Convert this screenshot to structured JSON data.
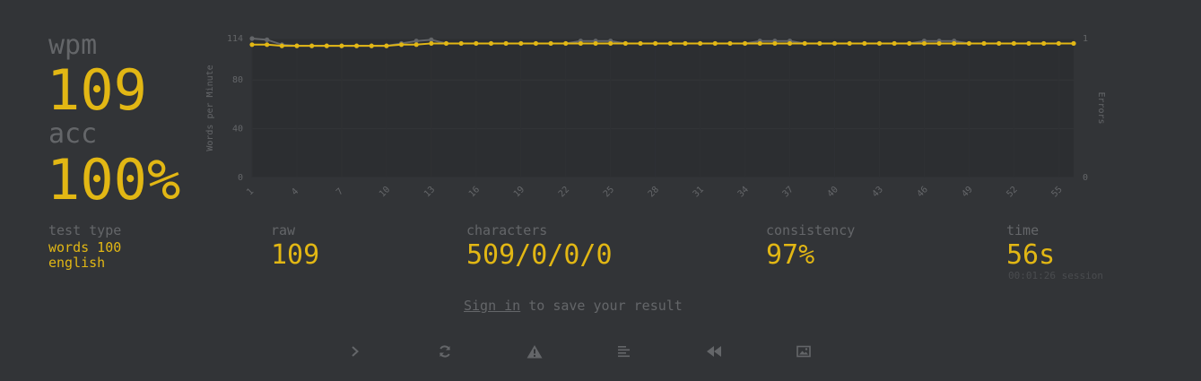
{
  "stats": {
    "wpm_label": "wpm",
    "wpm_value": "109",
    "acc_label": "acc",
    "acc_value": "100%"
  },
  "more": {
    "test_type_label": "test type",
    "test_type_line1": "words 100",
    "test_type_line2": "english",
    "raw_label": "raw",
    "raw_value": "109",
    "characters_label": "characters",
    "characters_value": "509/0/0/0",
    "consistency_label": "consistency",
    "consistency_value": "97%",
    "time_label": "time",
    "time_value": "56s",
    "session_text": "00:01:26 session"
  },
  "signin": {
    "link": "Sign in",
    "rest": " to save your result"
  },
  "buttons": [
    {
      "name": "next-test-button",
      "icon": "chevron-right-icon"
    },
    {
      "name": "restart-test-button",
      "icon": "refresh-icon"
    },
    {
      "name": "report-problem-button",
      "icon": "warning-icon"
    },
    {
      "name": "show-words-history-button",
      "icon": "align-left-icon"
    },
    {
      "name": "watch-replay-button",
      "icon": "backward-icon"
    },
    {
      "name": "save-screenshot-button",
      "icon": "image-icon"
    }
  ],
  "colors": {
    "background": "#323437",
    "accent": "#e2b714",
    "sub": "#646669",
    "chart_bg": "#2c2e31"
  },
  "chart_data": {
    "type": "line",
    "ylabel": "Words per Minute",
    "y2label": "Errors",
    "ylim": [
      0,
      114
    ],
    "y_ticks": [
      "0",
      "40",
      "80",
      "114"
    ],
    "y2lim": [
      0,
      1
    ],
    "y2_ticks": [
      "0",
      "1"
    ],
    "x": [
      1,
      2,
      3,
      4,
      5,
      6,
      7,
      8,
      9,
      10,
      11,
      12,
      13,
      14,
      15,
      16,
      17,
      18,
      19,
      20,
      21,
      22,
      23,
      24,
      25,
      26,
      27,
      28,
      29,
      30,
      31,
      32,
      33,
      34,
      35,
      36,
      37,
      38,
      39,
      40,
      41,
      42,
      43,
      44,
      45,
      46,
      47,
      48,
      49,
      50,
      51,
      52,
      53,
      54,
      55,
      56
    ],
    "x_ticks": [
      "1",
      "4",
      "7",
      "10",
      "13",
      "16",
      "19",
      "22",
      "25",
      "28",
      "31",
      "34",
      "37",
      "40",
      "43",
      "46",
      "49",
      "52",
      "55"
    ],
    "series": [
      {
        "name": "wpm",
        "color": "#e2b714",
        "values": [
          109,
          109,
          108,
          108,
          108,
          108,
          108,
          108,
          108,
          108,
          109,
          109,
          110,
          110,
          110,
          110,
          110,
          110,
          110,
          110,
          110,
          110,
          110,
          110,
          110,
          110,
          110,
          110,
          110,
          110,
          110,
          110,
          110,
          110,
          110,
          110,
          110,
          110,
          110,
          110,
          110,
          110,
          110,
          110,
          110,
          110,
          110,
          110,
          110,
          110,
          110,
          110,
          110,
          110,
          110,
          110
        ]
      },
      {
        "name": "raw",
        "color": "#646669",
        "values": [
          114,
          113,
          109,
          108,
          108,
          108,
          108,
          108,
          108,
          108,
          110,
          112,
          113,
          110,
          110,
          110,
          110,
          110,
          110,
          110,
          110,
          110,
          112,
          112,
          112,
          110,
          110,
          110,
          110,
          110,
          110,
          110,
          110,
          110,
          112,
          112,
          112,
          110,
          110,
          110,
          110,
          110,
          110,
          110,
          110,
          112,
          112,
          112,
          110,
          110,
          110,
          110,
          110,
          110,
          110,
          110
        ]
      }
    ]
  }
}
